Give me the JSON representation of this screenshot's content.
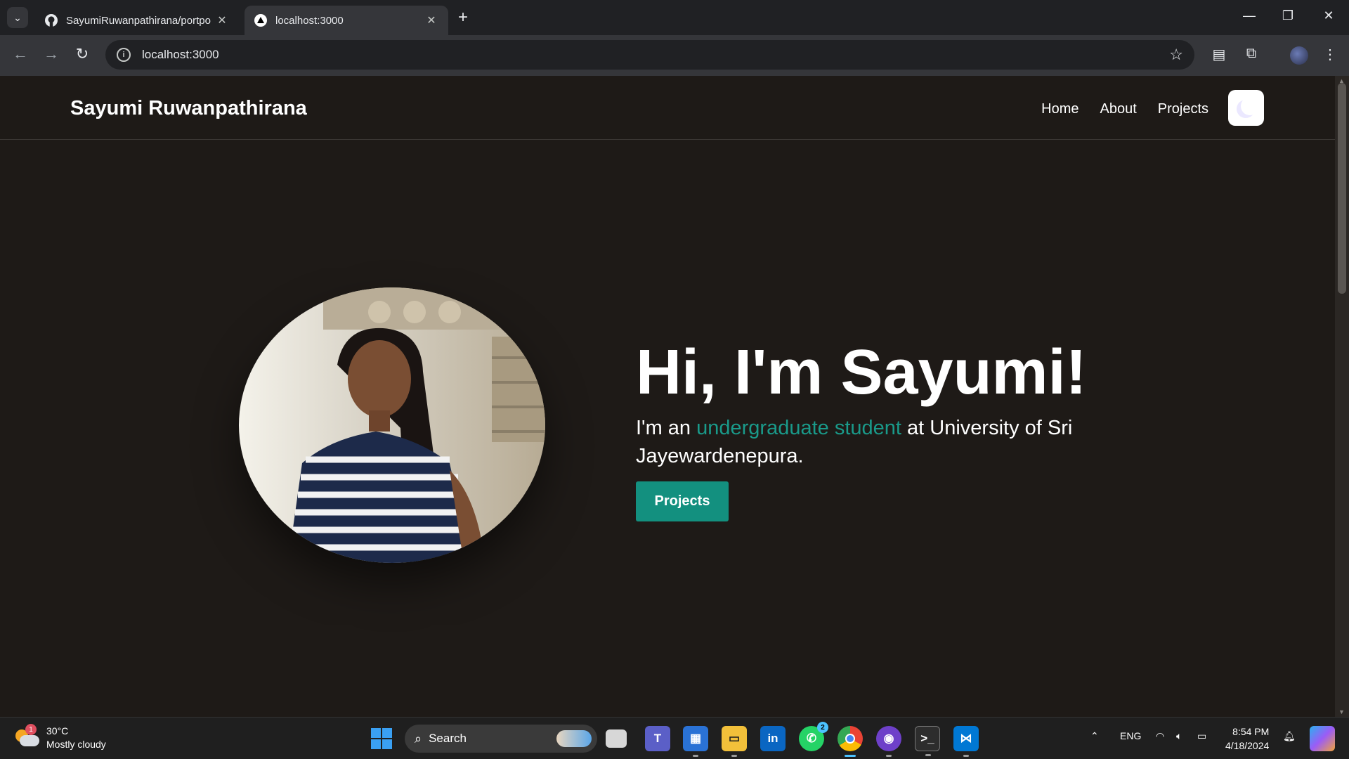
{
  "browser": {
    "tabs": [
      {
        "title": "SayumiRuwanpathirana/portpo",
        "favicon": "github-icon",
        "active": false
      },
      {
        "title": "localhost:3000",
        "favicon": "triangle-icon",
        "active": true
      }
    ],
    "address": "localhost:3000"
  },
  "site": {
    "brand": "Sayumi Ruwanpathirana",
    "nav": [
      {
        "label": "Home"
      },
      {
        "label": "About"
      },
      {
        "label": "Projects"
      }
    ]
  },
  "hero": {
    "title": "Hi, I'm Sayumi!",
    "sub_prefix": "I'm an ",
    "sub_accent": "undergraduate student",
    "sub_suffix": " at University of Sri Jayewardenepura.",
    "cta_label": "Projects",
    "accent_color": "#1a9a8a"
  },
  "taskbar": {
    "weather_temp": "30°C",
    "weather_desc": "Mostly cloudy",
    "weather_badge": "1",
    "search_label": "Search",
    "whatsapp_badge": "2",
    "language": "ENG",
    "time": "8:54 PM",
    "date": "4/18/2024"
  }
}
